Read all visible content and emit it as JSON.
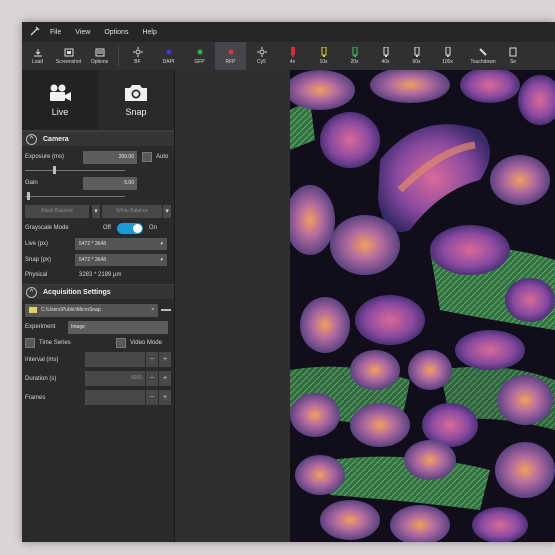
{
  "menu": {
    "items": [
      "File",
      "View",
      "Options",
      "Help"
    ]
  },
  "toolbar": {
    "buttons": [
      {
        "label": "Load",
        "icon": "load-icon"
      },
      {
        "label": "Screenshot",
        "icon": "screenshot-icon"
      },
      {
        "label": "Options",
        "icon": "options-icon"
      },
      {
        "label": "BF",
        "icon": "brightfield-icon"
      },
      {
        "label": "DAPI",
        "icon": "dapi-icon"
      },
      {
        "label": "GFP",
        "icon": "gfp-icon"
      },
      {
        "label": "RFP",
        "icon": "rfp-icon"
      },
      {
        "label": "Cy5",
        "icon": "cy5-icon"
      },
      {
        "label": "4x",
        "icon": "objective-icon"
      },
      {
        "label": "10x",
        "icon": "objective-icon"
      },
      {
        "label": "20x",
        "icon": "objective-icon"
      },
      {
        "label": "40x",
        "icon": "objective-icon"
      },
      {
        "label": "60x",
        "icon": "objective-icon"
      },
      {
        "label": "100x",
        "icon": "objective-icon"
      },
      {
        "label": "Touchdown",
        "icon": "touchdown-icon"
      },
      {
        "label": "Se",
        "icon": "settings-icon"
      }
    ],
    "active_index": 6
  },
  "modes": {
    "live_label": "Live",
    "snap_label": "Snap"
  },
  "camera": {
    "header": "Camera",
    "exposure_label": "Exposure (ms)",
    "exposure_value": "200.00",
    "auto_label": "Auto",
    "gain_label": "Gain",
    "gain_value": "5.00",
    "exposure_slider_fraction": 0.27,
    "gain_slider_fraction": 0.02,
    "balance_button_a": "Black Balance",
    "balance_button_b": "White Balance",
    "grayscale_label": "Grayscale Mode",
    "grayscale_off": "Off",
    "grayscale_on": "On",
    "live_px_label": "Live (px)",
    "live_px_value": "5472 * 3648",
    "snap_px_label": "Snap (px)",
    "snap_px_value": "5472 * 3648",
    "physical_label": "Physical",
    "physical_value": "3283 * 2189 µm"
  },
  "acquisition": {
    "header": "Acquisition Settings",
    "path_value": "C:\\Users\\Public\\MicroSnap",
    "experiment_label": "Experiment",
    "experiment_value": "Image",
    "time_series_label": "Time Series",
    "video_mode_label": "Video Mode",
    "interval_label": "Interval (ms)",
    "duration_label": "Duration (s)",
    "duration_value": "5000",
    "frames_label": "Frames"
  },
  "colors": {
    "accent": "#1c9bd6",
    "active_toolbar": "#46464a"
  }
}
